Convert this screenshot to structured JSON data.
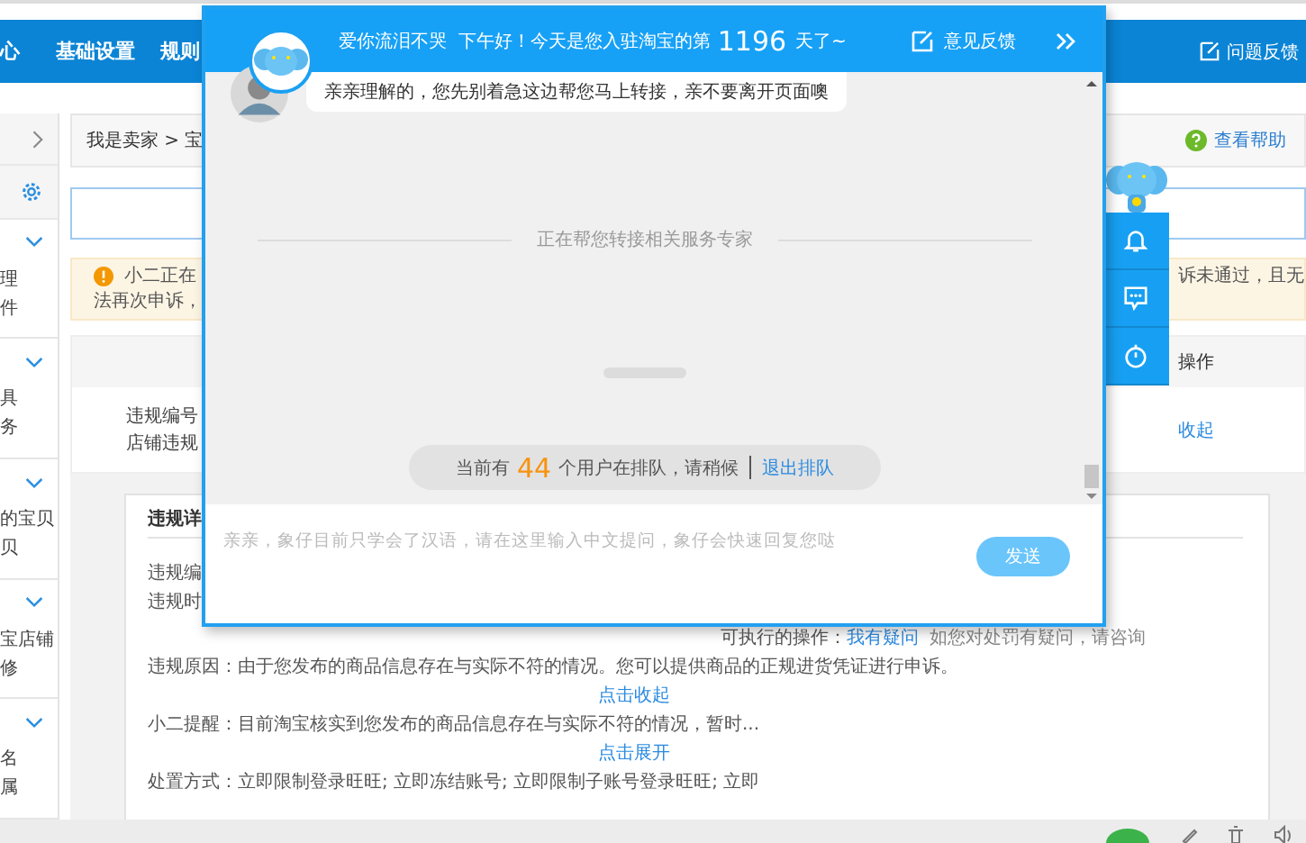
{
  "nav": {
    "items": [
      {
        "label": "心"
      },
      {
        "label": "基础设置"
      },
      {
        "label": "规则"
      }
    ],
    "feedback": "问题反馈"
  },
  "sidebar": {
    "groups": [
      {
        "items": [
          "理",
          "件"
        ]
      },
      {
        "items": [
          "具",
          "务"
        ]
      },
      {
        "items": [
          "的宝贝",
          "贝"
        ]
      },
      {
        "items": [
          "宝店铺",
          "修"
        ]
      },
      {
        "items": [
          "名",
          "属"
        ]
      }
    ]
  },
  "breadcrumb": "我是卖家 > 宝",
  "help": "查看帮助",
  "notice": {
    "line_1": "小二正在",
    "line_1_end": "诉未通过，且无",
    "line_2": "法再次申诉，"
  },
  "table": {
    "action_header": "操作",
    "row": {
      "id_label": "违规编号",
      "type": "店铺违规",
      "action": "收起"
    }
  },
  "details": {
    "title": "违规详",
    "rows": [
      {
        "kind": "field",
        "label": "违规编"
      },
      {
        "kind": "field",
        "label": "违规时"
      },
      {
        "kind": "field",
        "label": "违规原因：",
        "value": "由于您发布的商品信息存在与实际不符的情况。您可以提供商品的正规进货凭证进行申诉。"
      },
      {
        "kind": "link",
        "text": "点击收起"
      },
      {
        "kind": "field",
        "label": "小二提醒：",
        "value": "目前淘宝核实到您发布的商品信息存在与实际不符的情况，暂时..."
      },
      {
        "kind": "link",
        "text": "点击展开"
      },
      {
        "kind": "field",
        "label": "处置方式：",
        "value": "立即限制登录旺旺; 立即冻结账号; 立即限制子账号登录旺旺; 立即"
      }
    ],
    "actions": {
      "label": "可执行的操作：",
      "link": "我有疑问",
      "note": "如您对处罚有疑问，请咨询"
    }
  },
  "chat": {
    "greeting": "爱你流泪不哭  下午好！今天是您入驻淘宝的第",
    "days": "1196",
    "days_suffix": "天了~",
    "feedback": "意见反馈",
    "messages": [
      {
        "text": "亲亲理解的，您先别着急这边帮您马上转接，亲不要离开页面噢"
      }
    ],
    "status": "正在帮您转接相关服务专家",
    "queue": {
      "prefix": "当前有",
      "count": "44",
      "suffix": "个用户在排队，请稍候",
      "exit": "退出排队"
    },
    "input": {
      "placeholder": "亲亲，象仔目前只学会了汉语，请在这里输入中文提问，象仔会快速回复您哒"
    },
    "send": "发送"
  }
}
